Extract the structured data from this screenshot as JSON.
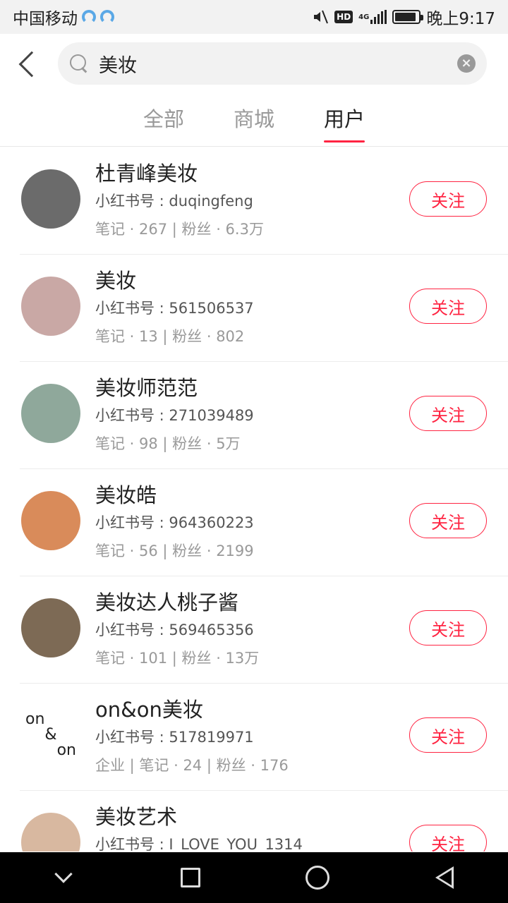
{
  "status_bar": {
    "carrier": "中国移动",
    "time": "晚上9:17",
    "hd_label": "HD",
    "network_label": "4G",
    "icons": [
      "carrier-icon",
      "mute-icon",
      "hd-icon",
      "signal-icon",
      "battery-icon"
    ]
  },
  "search": {
    "query": "美妆",
    "icons": [
      "back-arrow-icon",
      "search-icon",
      "clear-icon"
    ]
  },
  "tabs": [
    {
      "label": "全部",
      "active": false
    },
    {
      "label": "商城",
      "active": false
    },
    {
      "label": "用户",
      "active": true
    }
  ],
  "users": [
    {
      "name": "杜青峰美妆",
      "id_line": "小红书号 : duqingfeng",
      "stats": "笔记 · 267 | 粉丝 · 6.3万",
      "follow": "关注",
      "avatar_color": "#6b6b6b"
    },
    {
      "name": "美妆",
      "id_line": "小红书号 : 561506537",
      "stats": "笔记 · 13 | 粉丝 · 802",
      "follow": "关注",
      "avatar_color": "#c9a8a5"
    },
    {
      "name": "美妆师范范",
      "id_line": "小红书号 : 271039489",
      "stats": "笔记 · 98 | 粉丝 · 5万",
      "follow": "关注",
      "avatar_color": "#8fa89b"
    },
    {
      "name": "美妆皓",
      "id_line": "小红书号 : 964360223",
      "stats": "笔记 · 56 | 粉丝 · 2199",
      "follow": "关注",
      "avatar_color": "#d98b5a"
    },
    {
      "name": "美妆达人桃子酱",
      "id_line": "小红书号 : 569465356",
      "stats": "笔记 · 101 | 粉丝 · 13万",
      "follow": "关注",
      "avatar_color": "#7d6a55"
    },
    {
      "name": "on&on美妆",
      "id_line": "小红书号 : 517819971",
      "stats": "企业 | 笔记 · 24 | 粉丝 · 176",
      "follow": "关注",
      "avatar_color": "#ffffff"
    },
    {
      "name": "美妆艺术",
      "id_line": "小红书号 : I_LOVE_YOU_1314",
      "stats": "",
      "follow": "关注",
      "avatar_color": "#d8b8a0"
    }
  ],
  "avatar_logo": {
    "line1": "on",
    "line2": "&",
    "line3": "on"
  },
  "nav_bar": {
    "icons": [
      "nav-down-icon",
      "nav-recents-icon",
      "nav-home-icon",
      "nav-back-icon"
    ]
  },
  "colors": {
    "accent": "#ff2442",
    "nav_background": "#000000",
    "status_background": "#f2f2f2"
  }
}
